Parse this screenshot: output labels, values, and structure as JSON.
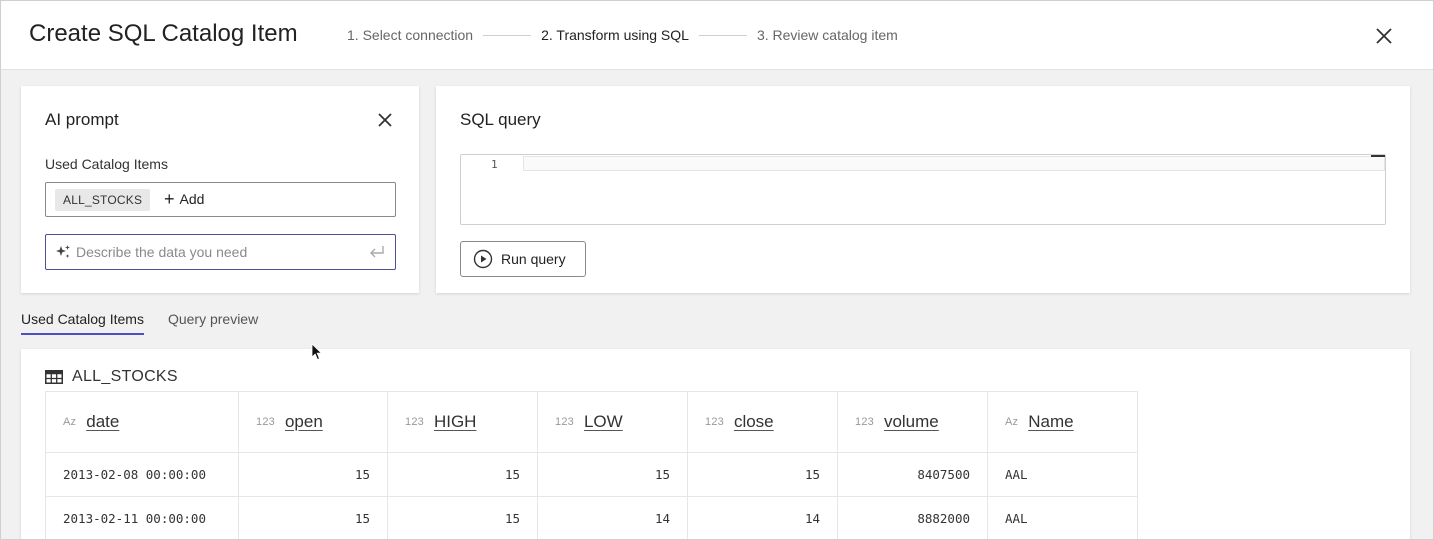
{
  "header": {
    "title": "Create SQL Catalog Item",
    "steps": [
      "1. Select connection",
      "2. Transform using SQL",
      "3. Review catalog item"
    ],
    "active_step": 1
  },
  "ai_prompt": {
    "title": "AI prompt",
    "used_label": "Used Catalog Items",
    "chip": "ALL_STOCKS",
    "add_label": "Add",
    "prompt_placeholder": "Describe the data you need"
  },
  "sql": {
    "title": "SQL query",
    "line_number": "1",
    "run_label": "Run query"
  },
  "tabs": [
    {
      "label": "Used Catalog Items",
      "active": true
    },
    {
      "label": "Query preview",
      "active": false
    }
  ],
  "dataset": {
    "name": "ALL_STOCKS",
    "columns": [
      {
        "type": "Az",
        "name": "date"
      },
      {
        "type": "123",
        "name": "open"
      },
      {
        "type": "123",
        "name": "HIGH"
      },
      {
        "type": "123",
        "name": "LOW"
      },
      {
        "type": "123",
        "name": "close"
      },
      {
        "type": "123",
        "name": "volume"
      },
      {
        "type": "Az",
        "name": "Name"
      }
    ],
    "rows": [
      [
        "2013-02-08 00:00:00",
        "15",
        "15",
        "15",
        "15",
        "8407500",
        "AAL"
      ],
      [
        "2013-02-11 00:00:00",
        "15",
        "15",
        "14",
        "14",
        "8882000",
        "AAL"
      ]
    ]
  },
  "colors": {
    "accent": "#4f4fc4",
    "prompt_border": "#4f4f9a"
  },
  "icons": [
    "close-icon",
    "sparkle-icon",
    "enter-icon",
    "play-icon",
    "table-icon",
    "mouse-pointer-icon"
  ]
}
